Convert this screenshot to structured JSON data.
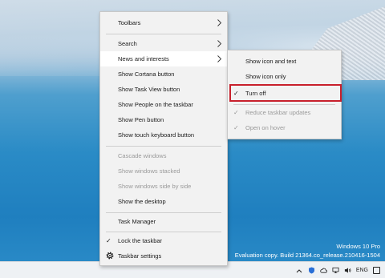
{
  "watermark": {
    "line1": "Windows 10 Pro",
    "line2": "Evaluation copy. Build 21364.co_release.210416-1504"
  },
  "context_menu": {
    "toolbars": "Toolbars",
    "search": "Search",
    "news_and_interests": "News and interests",
    "show_cortana": "Show Cortana button",
    "show_task_view": "Show Task View button",
    "show_people": "Show People on the taskbar",
    "show_pen": "Show Pen button",
    "show_touch_keyboard": "Show touch keyboard button",
    "cascade_windows": "Cascade windows",
    "show_windows_stacked": "Show windows stacked",
    "show_side_by_side": "Show windows side by side",
    "show_desktop": "Show the desktop",
    "task_manager": "Task Manager",
    "lock_taskbar": "Lock the taskbar",
    "taskbar_settings": "Taskbar settings"
  },
  "submenu": {
    "show_icon_and_text": "Show icon and text",
    "show_icon_only": "Show icon only",
    "turn_off": "Turn off",
    "reduce_updates": "Reduce taskbar updates",
    "open_on_hover": "Open on hover"
  },
  "check_glyph": "✓",
  "tray": {
    "language": "ENG"
  },
  "colors": {
    "highlight_border": "#c8202c",
    "menu_background": "#f2f2f2",
    "disabled_text": "#9a9a9a"
  }
}
